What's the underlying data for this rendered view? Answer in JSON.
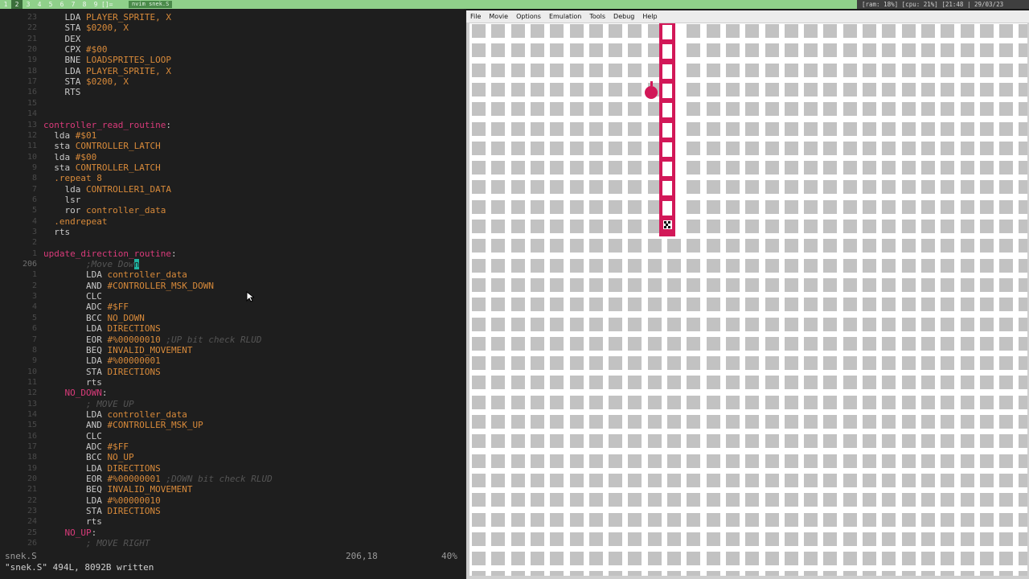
{
  "topbar": {
    "workspaces": [
      "1",
      "2",
      "3",
      "4",
      "5",
      "6",
      "7",
      "8",
      "9",
      "[]="
    ],
    "active_workspace": "2",
    "window_title": "nvim snek.S",
    "status": "[ram: 18%] [cpu: 21%] [21:48 | 29/03/23"
  },
  "editor": {
    "lines": [
      {
        "n": "23",
        "t": [
          [
            "    ",
            "kw"
          ],
          [
            "LDA ",
            "kw"
          ],
          [
            "PLAYER_SPRITE, X",
            "op"
          ]
        ]
      },
      {
        "n": "22",
        "t": [
          [
            "    ",
            "kw"
          ],
          [
            "STA ",
            "kw"
          ],
          [
            "$0200, X",
            "op"
          ]
        ]
      },
      {
        "n": "21",
        "t": [
          [
            "    ",
            "kw"
          ],
          [
            "DEX",
            "kw"
          ]
        ]
      },
      {
        "n": "20",
        "t": [
          [
            "    ",
            "kw"
          ],
          [
            "CPX ",
            "kw"
          ],
          [
            "#$00",
            "op"
          ]
        ]
      },
      {
        "n": "19",
        "t": [
          [
            "    ",
            "kw"
          ],
          [
            "BNE ",
            "kw"
          ],
          [
            "LOADSPRITES_LOOP",
            "op"
          ]
        ]
      },
      {
        "n": "18",
        "t": [
          [
            "    ",
            "kw"
          ],
          [
            "LDA ",
            "kw"
          ],
          [
            "PLAYER_SPRITE, X",
            "op"
          ]
        ]
      },
      {
        "n": "17",
        "t": [
          [
            "    ",
            "kw"
          ],
          [
            "STA ",
            "kw"
          ],
          [
            "$0200, X",
            "op"
          ]
        ]
      },
      {
        "n": "16",
        "t": [
          [
            "    ",
            "kw"
          ],
          [
            "RTS",
            "kw"
          ]
        ]
      },
      {
        "n": "15",
        "t": []
      },
      {
        "n": "14",
        "t": []
      },
      {
        "n": "13",
        "t": [
          [
            "controller_read_routine",
            "lbl"
          ],
          [
            ":",
            "kw"
          ]
        ]
      },
      {
        "n": "12",
        "t": [
          [
            "  ",
            "kw"
          ],
          [
            "lda ",
            "kw"
          ],
          [
            "#$01",
            "op"
          ]
        ]
      },
      {
        "n": "11",
        "t": [
          [
            "  ",
            "kw"
          ],
          [
            "sta ",
            "kw"
          ],
          [
            "CONTROLLER_LATCH",
            "op"
          ]
        ]
      },
      {
        "n": "10",
        "t": [
          [
            "  ",
            "kw"
          ],
          [
            "lda ",
            "kw"
          ],
          [
            "#$00",
            "op"
          ]
        ]
      },
      {
        "n": "9",
        "t": [
          [
            "  ",
            "kw"
          ],
          [
            "sta ",
            "kw"
          ],
          [
            "CONTROLLER_LATCH",
            "op"
          ]
        ]
      },
      {
        "n": "8",
        "t": [
          [
            "  ",
            "kw"
          ],
          [
            ".repeat ",
            "op"
          ],
          [
            "8",
            "op"
          ]
        ]
      },
      {
        "n": "7",
        "t": [
          [
            "    ",
            "kw"
          ],
          [
            "lda ",
            "kw"
          ],
          [
            "CONTROLLER1_DATA",
            "op"
          ]
        ]
      },
      {
        "n": "6",
        "t": [
          [
            "    ",
            "kw"
          ],
          [
            "lsr",
            "kw"
          ]
        ]
      },
      {
        "n": "5",
        "t": [
          [
            "    ",
            "kw"
          ],
          [
            "ror ",
            "kw"
          ],
          [
            "controller_data",
            "op"
          ]
        ]
      },
      {
        "n": "4",
        "t": [
          [
            "  ",
            "kw"
          ],
          [
            ".endrepeat",
            "op"
          ]
        ]
      },
      {
        "n": "3",
        "t": [
          [
            "  ",
            "kw"
          ],
          [
            "rts",
            "kw"
          ]
        ]
      },
      {
        "n": "2",
        "t": []
      },
      {
        "n": "1",
        "t": [
          [
            "update_direction_routine",
            "lbl"
          ],
          [
            ":",
            "kw"
          ]
        ]
      },
      {
        "n": "206",
        "cur": true,
        "t": [
          [
            "        ",
            "kw"
          ],
          [
            ";Move Dow",
            "cm"
          ],
          [
            "n",
            "cursor"
          ]
        ]
      },
      {
        "n": "1",
        "t": [
          [
            "        ",
            "kw"
          ],
          [
            "LDA ",
            "kw"
          ],
          [
            "controller_data",
            "op"
          ]
        ]
      },
      {
        "n": "2",
        "t": [
          [
            "        ",
            "kw"
          ],
          [
            "AND ",
            "kw"
          ],
          [
            "#CONTROLLER_MSK_DOWN",
            "op"
          ]
        ]
      },
      {
        "n": "3",
        "t": [
          [
            "        ",
            "kw"
          ],
          [
            "CLC",
            "kw"
          ]
        ]
      },
      {
        "n": "4",
        "t": [
          [
            "        ",
            "kw"
          ],
          [
            "ADC ",
            "kw"
          ],
          [
            "#$FF",
            "op"
          ]
        ]
      },
      {
        "n": "5",
        "t": [
          [
            "        ",
            "kw"
          ],
          [
            "BCC ",
            "kw"
          ],
          [
            "NO_DOWN",
            "op"
          ]
        ]
      },
      {
        "n": "6",
        "t": [
          [
            "        ",
            "kw"
          ],
          [
            "LDA ",
            "kw"
          ],
          [
            "DIRECTIONS",
            "op"
          ]
        ]
      },
      {
        "n": "7",
        "t": [
          [
            "        ",
            "kw"
          ],
          [
            "EOR ",
            "kw"
          ],
          [
            "#%00000010 ",
            "op"
          ],
          [
            ";UP bit check RLUD",
            "cm"
          ]
        ]
      },
      {
        "n": "8",
        "t": [
          [
            "        ",
            "kw"
          ],
          [
            "BEQ ",
            "kw"
          ],
          [
            "INVALID_MOVEMENT",
            "op"
          ]
        ]
      },
      {
        "n": "9",
        "t": [
          [
            "        ",
            "kw"
          ],
          [
            "LDA ",
            "kw"
          ],
          [
            "#%00000001",
            "op"
          ]
        ]
      },
      {
        "n": "10",
        "t": [
          [
            "        ",
            "kw"
          ],
          [
            "STA ",
            "kw"
          ],
          [
            "DIRECTIONS",
            "op"
          ]
        ]
      },
      {
        "n": "11",
        "t": [
          [
            "        ",
            "kw"
          ],
          [
            "rts",
            "kw"
          ]
        ]
      },
      {
        "n": "12",
        "t": [
          [
            "    ",
            "kw"
          ],
          [
            "NO_DOWN",
            "lbl"
          ],
          [
            ":",
            "kw"
          ]
        ]
      },
      {
        "n": "13",
        "t": [
          [
            "        ",
            "kw"
          ],
          [
            "; MOVE UP",
            "cm"
          ]
        ]
      },
      {
        "n": "14",
        "t": [
          [
            "        ",
            "kw"
          ],
          [
            "LDA ",
            "kw"
          ],
          [
            "controller_data",
            "op"
          ]
        ]
      },
      {
        "n": "15",
        "t": [
          [
            "        ",
            "kw"
          ],
          [
            "AND ",
            "kw"
          ],
          [
            "#CONTROLLER_MSK_UP",
            "op"
          ]
        ]
      },
      {
        "n": "16",
        "t": [
          [
            "        ",
            "kw"
          ],
          [
            "CLC",
            "kw"
          ]
        ]
      },
      {
        "n": "17",
        "t": [
          [
            "        ",
            "kw"
          ],
          [
            "ADC ",
            "kw"
          ],
          [
            "#$FF",
            "op"
          ]
        ]
      },
      {
        "n": "18",
        "t": [
          [
            "        ",
            "kw"
          ],
          [
            "BCC ",
            "kw"
          ],
          [
            "NO_UP",
            "op"
          ]
        ]
      },
      {
        "n": "19",
        "t": [
          [
            "        ",
            "kw"
          ],
          [
            "LDA ",
            "kw"
          ],
          [
            "DIRECTIONS",
            "op"
          ]
        ]
      },
      {
        "n": "20",
        "t": [
          [
            "        ",
            "kw"
          ],
          [
            "EOR ",
            "kw"
          ],
          [
            "#%00000001 ",
            "op"
          ],
          [
            ";DOWN bit check RLUD",
            "cm"
          ]
        ]
      },
      {
        "n": "21",
        "t": [
          [
            "        ",
            "kw"
          ],
          [
            "BEQ ",
            "kw"
          ],
          [
            "INVALID_MOVEMENT",
            "op"
          ]
        ]
      },
      {
        "n": "22",
        "t": [
          [
            "        ",
            "kw"
          ],
          [
            "LDA ",
            "kw"
          ],
          [
            "#%00000010",
            "op"
          ]
        ]
      },
      {
        "n": "23",
        "t": [
          [
            "        ",
            "kw"
          ],
          [
            "STA ",
            "kw"
          ],
          [
            "DIRECTIONS",
            "op"
          ]
        ]
      },
      {
        "n": "24",
        "t": [
          [
            "        ",
            "kw"
          ],
          [
            "rts",
            "kw"
          ]
        ]
      },
      {
        "n": "25",
        "t": [
          [
            "    ",
            "kw"
          ],
          [
            "NO_UP",
            "lbl"
          ],
          [
            ":",
            "kw"
          ]
        ]
      },
      {
        "n": "26",
        "t": [
          [
            "        ",
            "kw"
          ],
          [
            "; MOVE RIGHT",
            "cm"
          ]
        ]
      }
    ],
    "statusline": {
      "filename": "snek.S",
      "position": "206,18",
      "percent": "40%"
    },
    "cmdline": "\"snek.S\" 494L, 8092B written"
  },
  "emulator": {
    "menu": [
      "File",
      "Movie",
      "Options",
      "Emulation",
      "Tools",
      "Debug",
      "Help"
    ]
  },
  "colors": {
    "accent": "#d21858",
    "label": "#d93b7a",
    "operand": "#d88a3a",
    "cursor": "#1fb3a0",
    "bar": "#8fd08a"
  }
}
